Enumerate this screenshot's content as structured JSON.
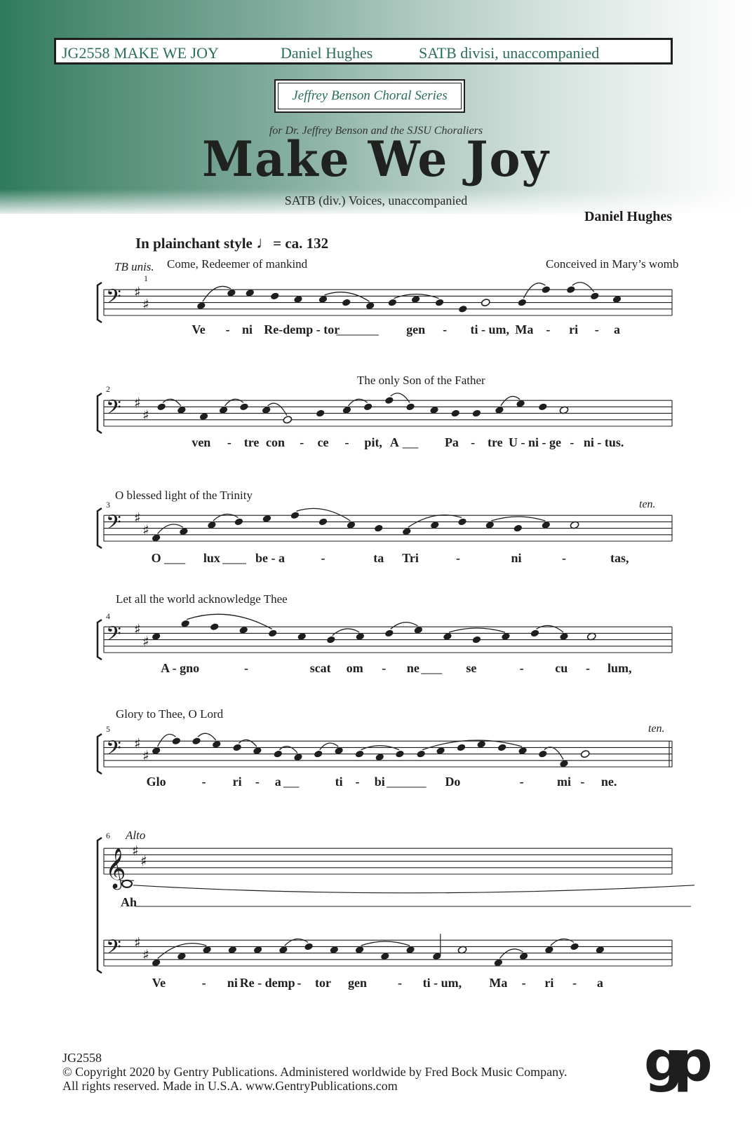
{
  "header": {
    "catalog_title": "JG2558  MAKE WE JOY",
    "composer": "Daniel Hughes",
    "voicing": "SATB divisi, unaccompanied"
  },
  "series": "Jeffrey Benson Choral Series",
  "dedication": "for Dr. Jeffrey Benson and the SJSU Choraliers",
  "title": "Make We Joy",
  "subtitle": "SATB (div.) Voices, unaccompanied",
  "composer_credit": "Daniel Hughes",
  "tempo": {
    "text": "In plainchant style",
    "glyph": "♩",
    "value": "= ca. 132"
  },
  "colors": {
    "accent": "#2f7a5e",
    "header_text": "#2a6f55",
    "ink": "#1e1e1e"
  },
  "systems": [
    {
      "measure": "1",
      "direction": "TB unis.",
      "translations": [
        "Come, Redeemer of mankind",
        "Conceived in Mary’s womb"
      ],
      "clef": "bass",
      "notes": [
        {
          "step": 3,
          "x": 0.115
        },
        {
          "step": 7,
          "x": 0.172
        },
        {
          "step": 7,
          "x": 0.207
        },
        {
          "step": 6,
          "x": 0.254
        },
        {
          "step": 5,
          "x": 0.298
        },
        {
          "step": 5,
          "x": 0.345
        },
        {
          "step": 4,
          "x": 0.389
        },
        {
          "step": 3,
          "x": 0.434
        },
        {
          "step": 4,
          "x": 0.476
        },
        {
          "step": 5,
          "x": 0.52
        },
        {
          "step": 4,
          "x": 0.565
        },
        {
          "step": 2,
          "x": 0.609
        },
        {
          "step": 4,
          "x": 0.652,
          "half": true
        },
        {
          "step": 4,
          "x": 0.721
        },
        {
          "step": 8,
          "x": 0.766
        },
        {
          "step": 8,
          "x": 0.813
        },
        {
          "step": 6,
          "x": 0.858
        },
        {
          "step": 5,
          "x": 0.9
        }
      ],
      "slurs": [
        [
          0,
          1
        ],
        [
          5,
          7
        ],
        [
          8,
          10
        ],
        [
          13,
          14
        ],
        [
          15,
          16
        ]
      ],
      "lyrics": [
        {
          "text": "Ve",
          "x": 0.11
        },
        {
          "text": "-",
          "x": 0.165
        },
        {
          "text": "ni",
          "x": 0.202
        },
        {
          "text": "Re-demp - tor",
          "x": 0.305
        },
        {
          "text": "gen",
          "x": 0.52
        },
        {
          "text": "-",
          "x": 0.575
        },
        {
          "text": "ti - um,",
          "x": 0.66
        },
        {
          "text": "Ma",
          "x": 0.725
        },
        {
          "text": "-",
          "x": 0.77
        },
        {
          "text": "ri",
          "x": 0.818
        },
        {
          "text": "-",
          "x": 0.862
        },
        {
          "text": "a",
          "x": 0.9
        }
      ],
      "extenders": [
        [
          0.37,
          0.45
        ]
      ]
    },
    {
      "measure": "2",
      "translations": [
        "The only Son of the Father"
      ],
      "clef": "bass",
      "notes": [
        {
          "step": 6,
          "x": 0.04
        },
        {
          "step": 5,
          "x": 0.078
        },
        {
          "step": 3,
          "x": 0.12
        },
        {
          "step": 5,
          "x": 0.157
        },
        {
          "step": 6,
          "x": 0.196
        },
        {
          "step": 5,
          "x": 0.238
        },
        {
          "step": 2,
          "x": 0.278,
          "half": true
        },
        {
          "step": 4,
          "x": 0.34
        },
        {
          "step": 5,
          "x": 0.39
        },
        {
          "step": 6,
          "x": 0.43
        },
        {
          "step": 8,
          "x": 0.47
        },
        {
          "step": 6,
          "x": 0.51
        },
        {
          "step": 5,
          "x": 0.555
        },
        {
          "step": 4,
          "x": 0.595
        },
        {
          "step": 4,
          "x": 0.635
        },
        {
          "step": 5,
          "x": 0.678
        },
        {
          "step": 7,
          "x": 0.718
        },
        {
          "step": 6,
          "x": 0.76
        },
        {
          "step": 5,
          "x": 0.8,
          "half": true
        }
      ],
      "slurs": [
        [
          0,
          1
        ],
        [
          3,
          4
        ],
        [
          5,
          6
        ],
        [
          8,
          9
        ],
        [
          10,
          11
        ],
        [
          15,
          16
        ]
      ],
      "lyrics": [
        {
          "text": "ven",
          "x": 0.115
        },
        {
          "text": "-",
          "x": 0.168
        },
        {
          "text": "tre",
          "x": 0.21
        },
        {
          "text": "con",
          "x": 0.255
        },
        {
          "text": "-",
          "x": 0.305
        },
        {
          "text": "ce",
          "x": 0.345
        },
        {
          "text": "-",
          "x": 0.39
        },
        {
          "text": "pit,",
          "x": 0.44
        },
        {
          "text": "A",
          "x": 0.48
        },
        {
          "text": "Pa",
          "x": 0.588
        },
        {
          "text": "-",
          "x": 0.628
        },
        {
          "text": "tre",
          "x": 0.67
        },
        {
          "text": "U - ni - ge",
          "x": 0.745
        },
        {
          "text": "-",
          "x": 0.815
        },
        {
          "text": "ni - tus.",
          "x": 0.875
        }
      ],
      "extenders": [
        [
          0.495,
          0.525
        ]
      ]
    },
    {
      "measure": "3",
      "translations": [
        "O blessed light of the Trinity"
      ],
      "tenuto_label": "ten.",
      "clef": "bass",
      "notes": [
        {
          "step": 1,
          "x": 0.03
        },
        {
          "step": 3,
          "x": 0.082
        },
        {
          "step": 5,
          "x": 0.135
        },
        {
          "step": 6,
          "x": 0.186
        },
        {
          "step": 7,
          "x": 0.239
        },
        {
          "step": 8,
          "x": 0.292
        },
        {
          "step": 6,
          "x": 0.345
        },
        {
          "step": 5,
          "x": 0.398
        },
        {
          "step": 4,
          "x": 0.45
        },
        {
          "step": 3,
          "x": 0.503
        },
        {
          "step": 5,
          "x": 0.556
        },
        {
          "step": 6,
          "x": 0.608
        },
        {
          "step": 5,
          "x": 0.66
        },
        {
          "step": 4,
          "x": 0.713
        },
        {
          "step": 5,
          "x": 0.766
        },
        {
          "step": 5,
          "x": 0.82,
          "half": true
        }
      ],
      "slurs": [
        [
          0,
          1
        ],
        [
          2,
          3
        ],
        [
          5,
          7
        ],
        [
          9,
          11
        ],
        [
          12,
          14
        ]
      ],
      "lyrics": [
        {
          "text": "O",
          "x": 0.03
        },
        {
          "text": "lux",
          "x": 0.135
        },
        {
          "text": "be - a",
          "x": 0.245
        },
        {
          "text": "-",
          "x": 0.345
        },
        {
          "text": "ta",
          "x": 0.45
        },
        {
          "text": "Tri",
          "x": 0.51
        },
        {
          "text": "-",
          "x": 0.6
        },
        {
          "text": "ni",
          "x": 0.71
        },
        {
          "text": "-",
          "x": 0.8
        },
        {
          "text": "tas,",
          "x": 0.905
        }
      ],
      "extenders": [
        [
          0.045,
          0.085
        ],
        [
          0.155,
          0.2
        ]
      ]
    },
    {
      "measure": "4",
      "translations": [
        "Let all the world acknowledge Thee"
      ],
      "clef": "bass",
      "notes": [
        {
          "step": 5,
          "x": 0.03
        },
        {
          "step": 9,
          "x": 0.085
        },
        {
          "step": 8,
          "x": 0.14
        },
        {
          "step": 7,
          "x": 0.195
        },
        {
          "step": 6,
          "x": 0.25
        },
        {
          "step": 5,
          "x": 0.305
        },
        {
          "step": 4,
          "x": 0.36
        },
        {
          "step": 5,
          "x": 0.415
        },
        {
          "step": 6,
          "x": 0.47
        },
        {
          "step": 7,
          "x": 0.525
        },
        {
          "step": 5,
          "x": 0.58
        },
        {
          "step": 4,
          "x": 0.635
        },
        {
          "step": 5,
          "x": 0.69
        },
        {
          "step": 6,
          "x": 0.745
        },
        {
          "step": 5,
          "x": 0.8
        },
        {
          "step": 5,
          "x": 0.852,
          "half": true
        }
      ],
      "slurs": [
        [
          1,
          4
        ],
        [
          6,
          7
        ],
        [
          8,
          9
        ],
        [
          10,
          12
        ],
        [
          13,
          14
        ]
      ],
      "lyrics": [
        {
          "text": "A - gno",
          "x": 0.075
        },
        {
          "text": "-",
          "x": 0.2
        },
        {
          "text": "scat",
          "x": 0.34
        },
        {
          "text": "om",
          "x": 0.405
        },
        {
          "text": "-",
          "x": 0.46
        },
        {
          "text": "ne",
          "x": 0.515
        },
        {
          "text": "se",
          "x": 0.625
        },
        {
          "text": "-",
          "x": 0.72
        },
        {
          "text": "cu",
          "x": 0.795
        },
        {
          "text": "-",
          "x": 0.845
        },
        {
          "text": "lum,",
          "x": 0.905
        }
      ],
      "extenders": [
        [
          0.53,
          0.57
        ]
      ]
    },
    {
      "measure": "5",
      "translations": [
        "Glory to Thee, O Lord"
      ],
      "tenuto_label": "ten.",
      "clef": "bass",
      "notes": [
        {
          "step": 5,
          "x": 0.03
        },
        {
          "step": 8,
          "x": 0.068
        },
        {
          "step": 8,
          "x": 0.106
        },
        {
          "step": 7,
          "x": 0.144
        },
        {
          "step": 6,
          "x": 0.183
        },
        {
          "step": 5,
          "x": 0.221
        },
        {
          "step": 4,
          "x": 0.26
        },
        {
          "step": 3,
          "x": 0.298
        },
        {
          "step": 4,
          "x": 0.336
        },
        {
          "step": 5,
          "x": 0.375
        },
        {
          "step": 4,
          "x": 0.414
        },
        {
          "step": 3,
          "x": 0.452
        },
        {
          "step": 4,
          "x": 0.49
        },
        {
          "step": 4,
          "x": 0.53
        },
        {
          "step": 5,
          "x": 0.567
        },
        {
          "step": 6,
          "x": 0.606
        },
        {
          "step": 7,
          "x": 0.644
        },
        {
          "step": 6,
          "x": 0.683
        },
        {
          "step": 5,
          "x": 0.722
        },
        {
          "step": 4,
          "x": 0.76
        },
        {
          "step": 1,
          "x": 0.8
        },
        {
          "step": 4,
          "x": 0.84,
          "half": true
        }
      ],
      "slurs": [
        [
          0,
          1
        ],
        [
          2,
          3
        ],
        [
          4,
          5
        ],
        [
          6,
          7
        ],
        [
          8,
          9
        ],
        [
          10,
          12
        ],
        [
          13,
          18
        ],
        [
          19,
          20
        ]
      ],
      "lyrics": [
        {
          "text": "Glo",
          "x": 0.03
        },
        {
          "text": "-",
          "x": 0.12
        },
        {
          "text": "ri",
          "x": 0.183
        },
        {
          "text": "-",
          "x": 0.221
        },
        {
          "text": "a",
          "x": 0.26
        },
        {
          "text": "ti",
          "x": 0.375
        },
        {
          "text": "-",
          "x": 0.41
        },
        {
          "text": "bi",
          "x": 0.452
        },
        {
          "text": "Do",
          "x": 0.59
        },
        {
          "text": "-",
          "x": 0.72
        },
        {
          "text": "mi",
          "x": 0.8
        },
        {
          "text": "-",
          "x": 0.835
        },
        {
          "text": "ne.",
          "x": 0.885
        }
      ],
      "extenders": [
        [
          0.27,
          0.3
        ],
        [
          0.465,
          0.54
        ]
      ]
    },
    {
      "measure": "6",
      "part_label": "Alto",
      "alto_syllable": "Ah",
      "clef": "bass",
      "notes": [
        {
          "step": 1,
          "x": 0.03
        },
        {
          "step": 3,
          "x": 0.078
        },
        {
          "step": 5,
          "x": 0.126
        },
        {
          "step": 5,
          "x": 0.174
        },
        {
          "step": 5,
          "x": 0.222
        },
        {
          "step": 5,
          "x": 0.27
        },
        {
          "step": 6,
          "x": 0.318
        },
        {
          "step": 5,
          "x": 0.366
        },
        {
          "step": 5,
          "x": 0.414
        },
        {
          "step": 3,
          "x": 0.462
        },
        {
          "step": 5,
          "x": 0.51
        },
        {
          "step": 3,
          "x": 0.56,
          "stem": true
        },
        {
          "step": 5,
          "x": 0.608,
          "half": true
        },
        {
          "step": 1,
          "x": 0.676
        },
        {
          "step": 3,
          "x": 0.724
        },
        {
          "step": 5,
          "x": 0.772
        },
        {
          "step": 6,
          "x": 0.82
        },
        {
          "step": 5,
          "x": 0.868
        }
      ],
      "slurs": [
        [
          0,
          2
        ],
        [
          5,
          6
        ],
        [
          8,
          10
        ],
        [
          13,
          14
        ],
        [
          15,
          16
        ]
      ],
      "lyrics": [
        {
          "text": "Ve",
          "x": 0.035
        },
        {
          "text": "-",
          "x": 0.12
        },
        {
          "text": "ni",
          "x": 0.174
        },
        {
          "text": "Re - demp",
          "x": 0.24
        },
        {
          "text": "-",
          "x": 0.3
        },
        {
          "text": "tor",
          "x": 0.345
        },
        {
          "text": "gen",
          "x": 0.41
        },
        {
          "text": "-",
          "x": 0.49
        },
        {
          "text": "ti - um,",
          "x": 0.57
        },
        {
          "text": "Ma",
          "x": 0.676
        },
        {
          "text": "-",
          "x": 0.724
        },
        {
          "text": "ri",
          "x": 0.772
        },
        {
          "text": "-",
          "x": 0.82
        },
        {
          "text": "a",
          "x": 0.868
        }
      ]
    }
  ],
  "footer": {
    "catalog": "JG2558",
    "copyright": "© Copyright 2020 by Gentry Publications. Administered worldwide by Fred Bock Music Company.",
    "rights": "All rights reserved. Made in U.S.A. www.GentryPublications.com",
    "logo": "gp"
  }
}
